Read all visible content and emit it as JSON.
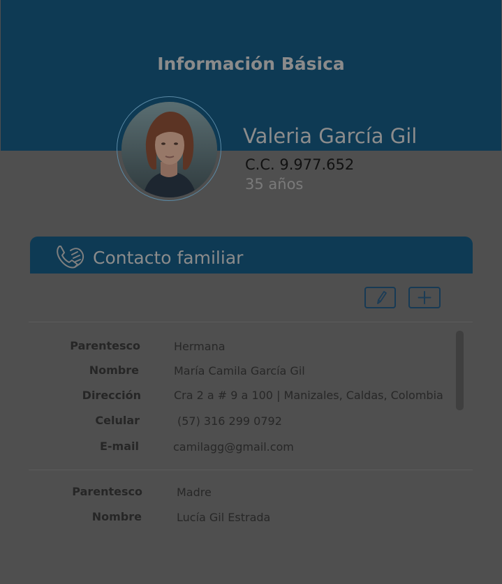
{
  "header": {
    "title": "Información Básica"
  },
  "profile": {
    "name": "Valeria García Gil",
    "id_text": "C.C. 9.977.652",
    "age_text": "35 años"
  },
  "section": {
    "title": "Contacto familiar",
    "icon": "phone-hand-icon"
  },
  "toolbar": {
    "edit_icon": "pencil-icon",
    "add_icon": "plus-icon"
  },
  "contacts": [
    {
      "fields": [
        {
          "label": "Parentesco",
          "value": "Hermana"
        },
        {
          "label": "Nombre",
          "value": "María Camila García Gil"
        },
        {
          "label": "Dirección",
          "value": "Cra 2 a # 9 a 100 | Manizales, Caldas, Colombia"
        },
        {
          "label": "Celular",
          "value": "(57) 316 299 0792"
        },
        {
          "label": "E-mail",
          "value": "camilagg@gmail.com"
        }
      ]
    },
    {
      "fields": [
        {
          "label": "Parentesco",
          "value": "Madre"
        },
        {
          "label": "Nombre",
          "value": "Lucía Gil Estrada"
        }
      ]
    }
  ]
}
